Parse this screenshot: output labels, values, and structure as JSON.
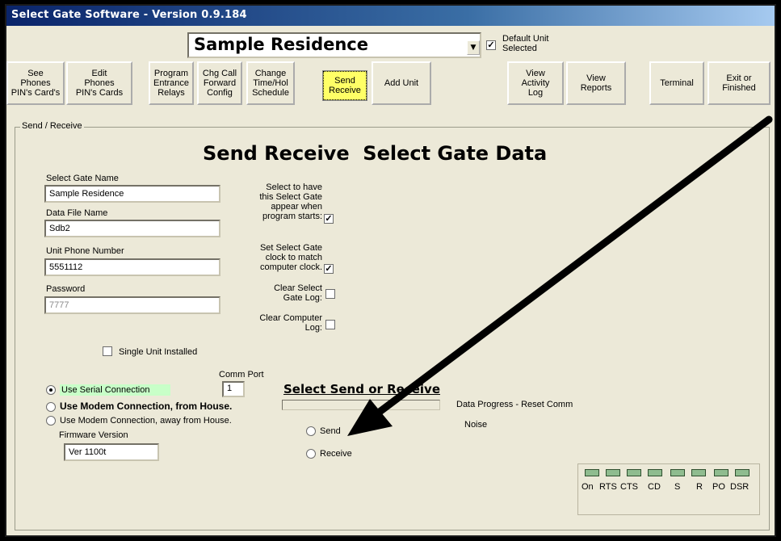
{
  "window": {
    "title": "Select Gate Software - Version 0.9.184"
  },
  "unit_selector": {
    "value": "Sample Residence",
    "arrow": "dropdown-arrow-icon"
  },
  "default_unit": {
    "label": "Default Unit Selected",
    "checked": true
  },
  "toolbar": {
    "see_phones": "See\nPhones\nPIN's Card's",
    "edit_phones": "Edit\nPhones\nPIN's Cards",
    "program_relays": "Program\nEntrance\nRelays",
    "chg_call_forward": "Chg Call\nForward\nConfig",
    "change_time": "Change\nTime/Hol\nSchedule",
    "send_receive": "Send\nReceive",
    "add_unit": "Add Unit",
    "view_activity": "View\nActivity\nLog",
    "view_reports": "View\nReports",
    "terminal": "Terminal",
    "exit": "Exit or\nFinished"
  },
  "group": {
    "legend": "Send / Receive",
    "heading": "Send Receive  Select Gate Data"
  },
  "fields": {
    "gate_name_label": "Select Gate Name",
    "gate_name_value": "Sample Residence",
    "data_file_label": "Data File Name",
    "data_file_value": "Sdb2",
    "phone_label": "Unit Phone Number",
    "phone_value": "5551112",
    "password_label": "Password",
    "password_value": "7777"
  },
  "options": {
    "appear_startup": "Select to have\nthis Select Gate\nappear when\nprogram starts:",
    "set_clock": "Set Select Gate\nclock to match\ncomputer clock.",
    "clear_gate_log": "Clear Select\nGate Log:",
    "clear_computer_log": "Clear Computer\nLog:",
    "single_unit": "Single Unit Installed"
  },
  "connection": {
    "comm_port_label": "Comm Port",
    "comm_port_value": "1",
    "serial": "Use Serial Connection",
    "modem_from": "Use Modem Connection, from House.",
    "modem_away": "Use Modem Connection, away from House.",
    "firmware_label": "Firmware Version",
    "firmware_value": "Ver 1100t"
  },
  "transfer": {
    "title": "Select Send or Receive",
    "send": "Send",
    "receive": "Receive",
    "progress_label": "Data Progress - Reset Comm",
    "noise_label": "Noise"
  },
  "leds": [
    "On",
    "RTS",
    "CTS",
    "CD",
    "S",
    "R",
    "PO",
    "DSR"
  ],
  "colors": {
    "send_button": "#ffff66",
    "serial_highlight": "#c8ffc8",
    "led": "#8fbc8f"
  }
}
